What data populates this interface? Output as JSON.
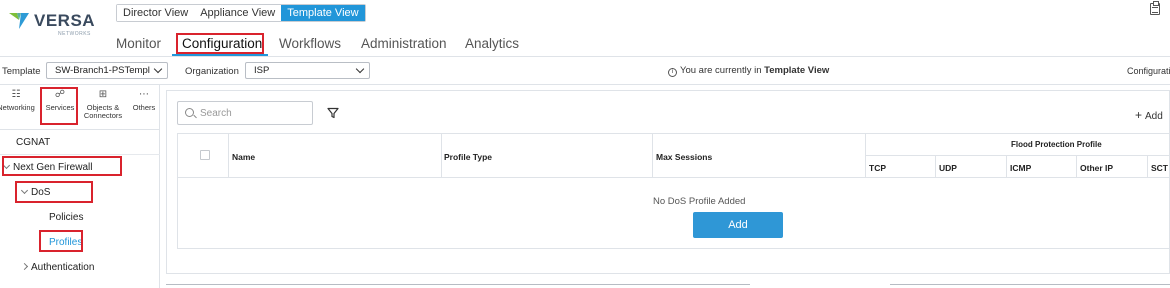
{
  "logo": {
    "brand": "VERSA",
    "sub": "NETWORKS"
  },
  "view_switch": [
    "Director View",
    "Appliance View",
    "Template View"
  ],
  "main_nav": [
    "Monitor",
    "Configuration",
    "Workflows",
    "Administration",
    "Analytics"
  ],
  "template_bar": {
    "template_label": "Template",
    "template_value": "SW-Branch1-PSTempl",
    "organization_label": "Organization",
    "organization_value": "ISP",
    "info_prefix": "You are currently in",
    "info_view": "Template View",
    "right_label": "Configuratio"
  },
  "left_tabs": {
    "networking": "Networking",
    "services": "Services",
    "objects_line1": "Objects &",
    "objects_line2": "Connectors",
    "others": "Others"
  },
  "tree": {
    "cgnat": "CGNAT",
    "ngfw": "Next Gen Firewall",
    "dos": "DoS",
    "policies": "Policies",
    "profiles": "Profiles",
    "authentication": "Authentication"
  },
  "content": {
    "search_placeholder": "Search",
    "add_link": "Add",
    "columns": {
      "name": "Name",
      "profile_type": "Profile Type",
      "max_sessions": "Max Sessions",
      "flood_group": "Flood Protection Profile",
      "tcp": "TCP",
      "udp": "UDP",
      "icmp": "ICMP",
      "other_ip": "Other IP",
      "sctp": "SCT"
    },
    "empty_message": "No DoS Profile Added",
    "add_button": "Add"
  },
  "colors": {
    "accent": "#2196d9",
    "highlight": "#d9232d"
  }
}
